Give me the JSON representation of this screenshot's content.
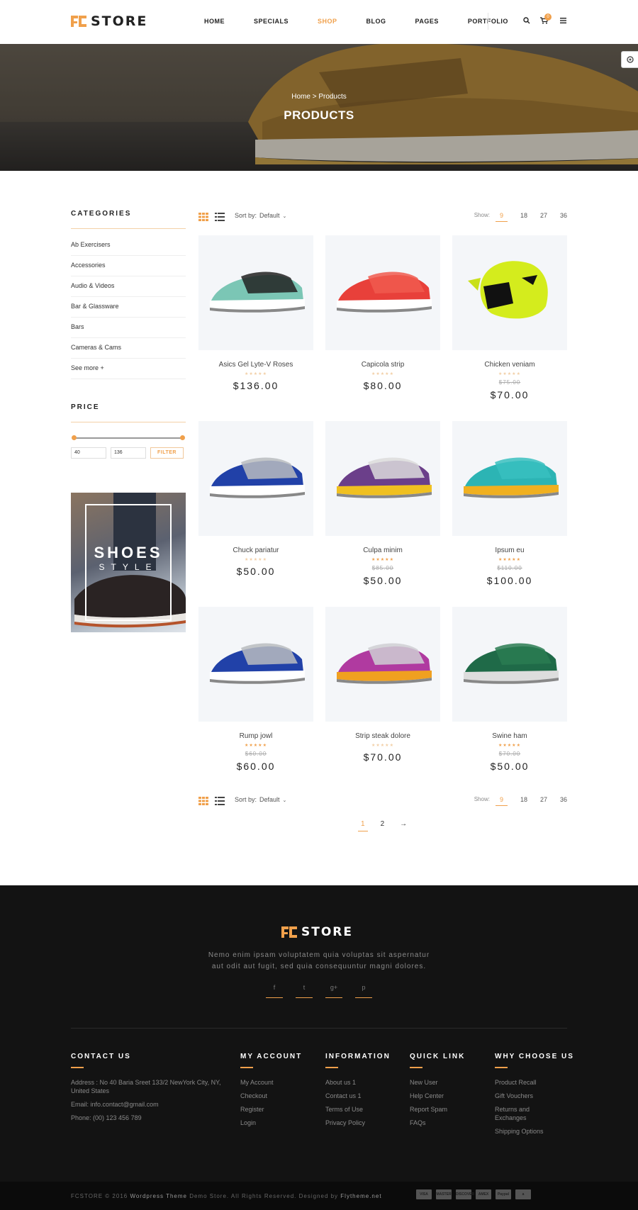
{
  "header": {
    "logo": "STORE",
    "nav": [
      "HOME",
      "SPECIALS",
      "SHOP",
      "BLOG",
      "PAGES",
      "PORTFOLIO"
    ],
    "active_nav": "SHOP",
    "cart_count": "0",
    "icons": [
      "search-icon",
      "cart-icon",
      "menu-icon"
    ]
  },
  "hero": {
    "breadcrumb_home": "Home",
    "breadcrumb_sep": ">",
    "breadcrumb_current": "Products",
    "title": "PRODUCTS"
  },
  "sidebar": {
    "categories_title": "CATEGORIES",
    "categories": [
      "Ab Exercisers",
      "Accessories",
      "Audio & Videos",
      "Bar & Glassware",
      "Bars",
      "Cameras & Cams",
      "See more +"
    ],
    "price_title": "PRICE",
    "price_min": "40",
    "price_max": "136",
    "filter_label": "FILTER",
    "banner_title": "SHOES",
    "banner_sub": "STYLE"
  },
  "toolbar": {
    "sort_label": "Sort by:",
    "sort_value": "Default",
    "show_label": "Show:",
    "show_options": [
      "9",
      "18",
      "27",
      "36"
    ],
    "show_selected": "9"
  },
  "products": [
    {
      "name": "Asics Gel Lyte-V Roses",
      "old_price": "",
      "price": "$136.00",
      "rated": false
    },
    {
      "name": "Capicola strip",
      "old_price": "",
      "price": "$80.00",
      "rated": false
    },
    {
      "name": "Chicken veniam",
      "old_price": "$75.00",
      "price": "$70.00",
      "rated": false
    },
    {
      "name": "Chuck pariatur",
      "old_price": "",
      "price": "$50.00",
      "rated": false
    },
    {
      "name": "Culpa minim",
      "old_price": "$85.00",
      "price": "$50.00",
      "rated": true
    },
    {
      "name": "Ipsum eu",
      "old_price": "$110.00",
      "price": "$100.00",
      "rated": true
    },
    {
      "name": "Rump jowl",
      "old_price": "$60.00",
      "price": "$60.00",
      "rated": true
    },
    {
      "name": "Strip steak dolore",
      "old_price": "",
      "price": "$70.00",
      "rated": false
    },
    {
      "name": "Swine ham",
      "old_price": "$70.00",
      "price": "$50.00",
      "rated": true
    }
  ],
  "pagination": [
    "1",
    "2",
    "→"
  ],
  "footer": {
    "logo": "STORE",
    "desc_line1": "Nemo enim ipsam voluptatem quia voluptas sit aspernatur",
    "desc_line2": "aut odit aut fugit, sed quia consequuntur magni dolores.",
    "social": [
      "f",
      "t",
      "g+",
      "p"
    ],
    "contact_title": "CONTACT US",
    "contact_address": "Address : No 40 Baria Sreet 133/2 NewYork City, NY, United States",
    "contact_email": "Email: info.contact@gmail.com",
    "contact_phone": "Phone: (00) 123 456 789",
    "cols": [
      {
        "title": "MY ACCOUNT",
        "links": [
          "My Account",
          "Checkout",
          "Register",
          "Login"
        ]
      },
      {
        "title": "INFORMATION",
        "links": [
          "About us 1",
          "Contact us 1",
          "Terms of Use",
          "Privacy Policy"
        ]
      },
      {
        "title": "QUICK LINK",
        "links": [
          "New User",
          "Help Center",
          "Report Spam",
          "FAQs"
        ]
      },
      {
        "title": "WHY CHOOSE US",
        "links": [
          "Product Recall",
          "Gift Vouchers",
          "Returns and Exchanges",
          "Shipping Options"
        ]
      }
    ],
    "copyright_a": "FCSTORE © 2016",
    "copyright_b": "Wordpress Theme",
    "copyright_c": "Demo Store. All Rights Reserved. Designed by",
    "copyright_d": "Flytheme.net",
    "payments": [
      "VISA",
      "MASTER",
      "DISCOVER",
      "AMEX",
      "Paypal",
      "a"
    ]
  },
  "colors": {
    "accent": "#f0a04b",
    "footer_bg": "#131313",
    "card_bg": "#f4f6f9"
  }
}
